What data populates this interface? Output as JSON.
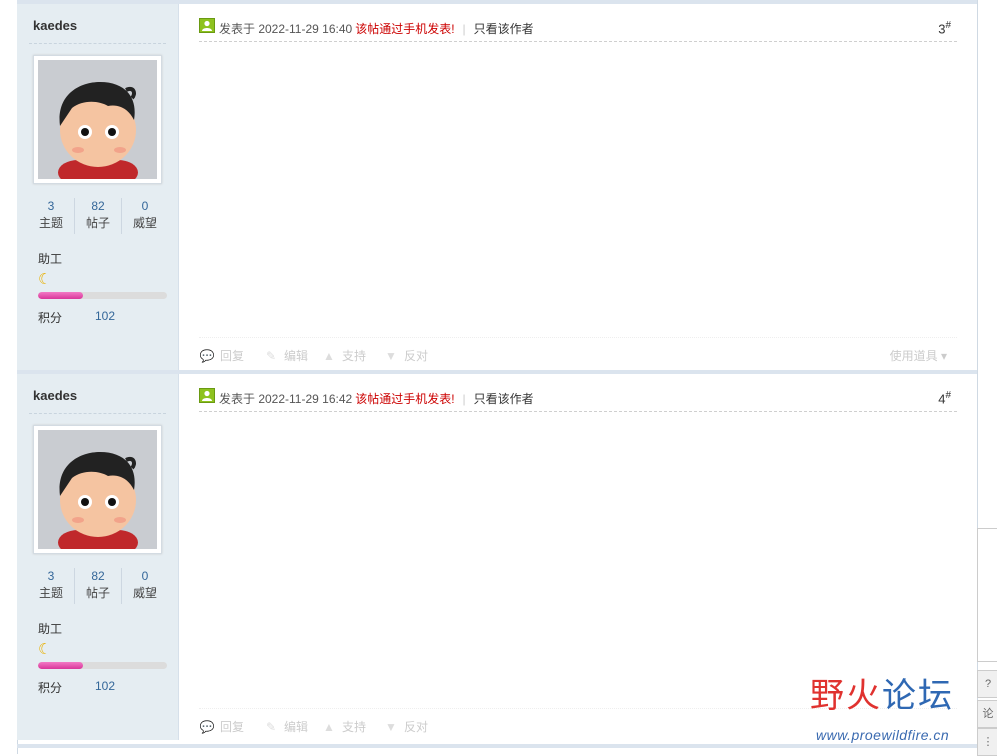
{
  "posts": [
    {
      "author": "kaedes",
      "stats": [
        {
          "value": "3",
          "label": "主题"
        },
        {
          "value": "82",
          "label": "帖子"
        },
        {
          "value": "0",
          "label": "威望"
        }
      ],
      "rank": "助工",
      "credits_label": "积分",
      "credits": "102",
      "credit_progress": 0.35,
      "posted": "发表于 2022-11-29 16:40",
      "mobile": "该帖通过手机发表!",
      "author_only": "只看该作者",
      "floor": "3",
      "floor_mark": "#"
    },
    {
      "author": "kaedes",
      "stats": [
        {
          "value": "3",
          "label": "主题"
        },
        {
          "value": "82",
          "label": "帖子"
        },
        {
          "value": "0",
          "label": "威望"
        }
      ],
      "rank": "助工",
      "credits_label": "积分",
      "credits": "102",
      "credit_progress": 0.35,
      "posted": "发表于 2022-11-29 16:42",
      "mobile": "该帖通过手机发表!",
      "author_only": "只看该作者",
      "floor": "4",
      "floor_mark": "#"
    }
  ],
  "actions": {
    "reply": "回复",
    "edit": "编辑",
    "support": "支持",
    "oppose": "反对",
    "tools": "使用道具"
  },
  "watermark": {
    "cn": "野火论坛",
    "url": "www.proewildfire.cn"
  },
  "side": {
    "btn1": "?",
    "btn2": "论",
    "btn3": "⋮"
  }
}
